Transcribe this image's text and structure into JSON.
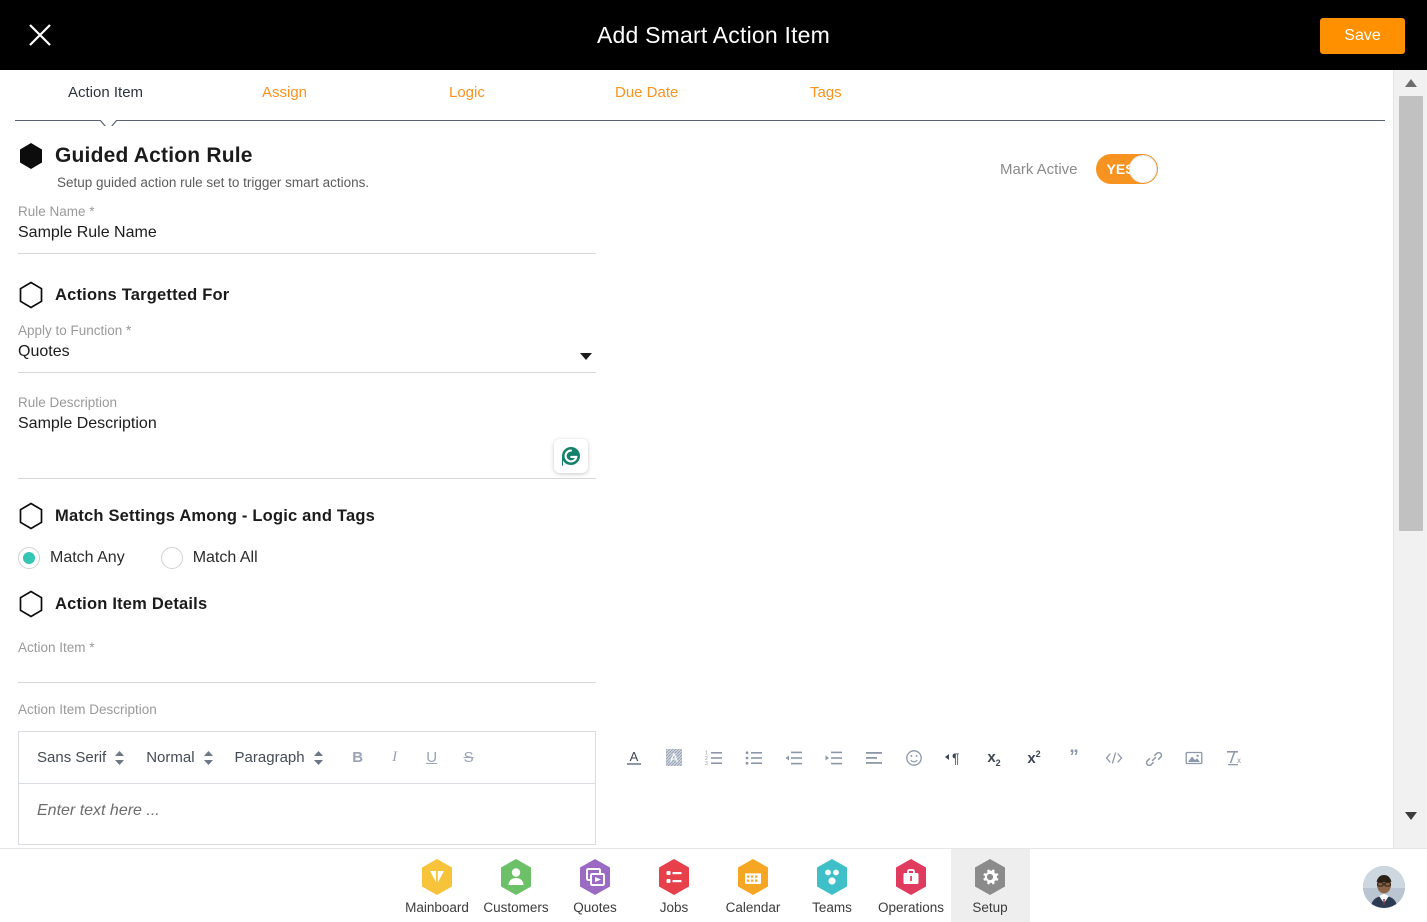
{
  "topbar": {
    "title": "Add Smart Action Item",
    "close_icon": "close-icon",
    "save_label": "Save"
  },
  "tabs": [
    {
      "label": "Action Item",
      "active": true
    },
    {
      "label": "Assign",
      "active": false
    },
    {
      "label": "Logic",
      "active": false
    },
    {
      "label": "Due Date",
      "active": false
    },
    {
      "label": "Tags",
      "active": false
    }
  ],
  "main": {
    "mark_active": {
      "label": "Mark Active",
      "toggle_value": "YES",
      "on": true,
      "on_color": "#f79321"
    },
    "section_rule": {
      "title": "Guided Action Rule",
      "subtitle": "Setup guided action rule set to trigger smart actions.",
      "bullet": "hexagon-filled-icon"
    },
    "rule_name": {
      "label": "Rule Name *",
      "value": "Sample Rule Name"
    },
    "section_targeted": {
      "title": "Actions Targetted For",
      "bullet": "hexagon-outline-icon"
    },
    "apply_to_function": {
      "label": "Apply to Function *",
      "value": "Quotes",
      "dropdown_icon": "chevron-down-icon"
    },
    "rule_description": {
      "label": "Rule Description",
      "value": "Sample Description",
      "assistant_icon": "grammarly-icon",
      "assistant_color": "#15806c"
    },
    "section_match": {
      "title": "Match Settings Among - Logic and Tags",
      "bullet": "hexagon-outline-icon"
    },
    "match_options": [
      {
        "label": "Match Any",
        "selected": true
      },
      {
        "label": "Match All",
        "selected": false
      }
    ],
    "match_accent": "#34c5b4",
    "section_action_details": {
      "title": "Action Item Details",
      "bullet": "hexagon-outline-icon"
    },
    "action_item": {
      "label": "Action Item *",
      "value": ""
    },
    "action_item_description": {
      "label": "Action Item Description",
      "editor": {
        "font_family": "Sans Serif",
        "font_size": "Normal",
        "block_style": "Paragraph",
        "bold": "B",
        "italic": "I",
        "underline": "U",
        "strike": "S",
        "placeholder": "Enter text here ...",
        "overflow_tools": [
          "text-color-icon",
          "highlight-color-icon",
          "ordered-list-icon",
          "bullet-list-icon",
          "outdent-icon",
          "indent-icon",
          "align-icon",
          "emoji-icon",
          "text-direction-icon",
          "subscript-icon",
          "superscript-icon",
          "blockquote-icon",
          "code-icon",
          "link-icon",
          "image-icon",
          "clear-format-icon"
        ]
      }
    }
  },
  "scrollbar": {
    "up_icon": "scroll-up-icon",
    "down_icon": "scroll-down-icon",
    "thumb": "scroll-thumb"
  },
  "bottom_nav": {
    "items": [
      {
        "label": "Mainboard",
        "icon": "mainboard-icon",
        "color": "#f7c33b",
        "active": false
      },
      {
        "label": "Customers",
        "icon": "customers-icon",
        "color": "#6cc168",
        "active": false
      },
      {
        "label": "Quotes",
        "icon": "quotes-icon",
        "color": "#9b6bc4",
        "active": false
      },
      {
        "label": "Jobs",
        "icon": "jobs-icon",
        "color": "#e8404a",
        "active": false
      },
      {
        "label": "Calendar",
        "icon": "calendar-icon",
        "color": "#f5a623",
        "active": false
      },
      {
        "label": "Teams",
        "icon": "teams-icon",
        "color": "#3fc0c8",
        "active": false
      },
      {
        "label": "Operations",
        "icon": "operations-icon",
        "color": "#e03a5f",
        "active": false
      },
      {
        "label": "Setup",
        "icon": "setup-gear-icon",
        "color": "#8b8b8b",
        "active": true
      }
    ],
    "avatar": "user-avatar"
  }
}
